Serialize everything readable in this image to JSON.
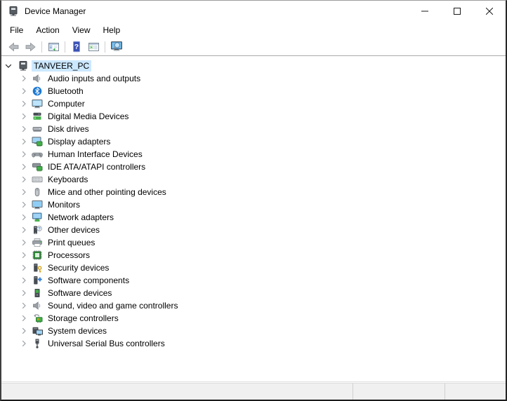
{
  "window": {
    "title": "Device Manager",
    "icon": "device-manager-icon"
  },
  "titlebar": {
    "controls": [
      {
        "name": "minimize",
        "icon": "minimize-icon"
      },
      {
        "name": "maximize",
        "icon": "maximize-icon"
      },
      {
        "name": "close",
        "icon": "close-icon"
      }
    ]
  },
  "menubar": {
    "items": [
      {
        "label": "File"
      },
      {
        "label": "Action"
      },
      {
        "label": "View"
      },
      {
        "label": "Help"
      }
    ]
  },
  "toolbar": {
    "buttons": [
      {
        "name": "back",
        "icon": "back-arrow-icon"
      },
      {
        "name": "forward",
        "icon": "forward-arrow-icon"
      },
      {
        "sep": true
      },
      {
        "name": "show-console-tree",
        "icon": "console-tree-icon"
      },
      {
        "sep": true
      },
      {
        "name": "help",
        "icon": "help-icon"
      },
      {
        "name": "show-action-pane",
        "icon": "action-pane-icon"
      },
      {
        "sep": true
      },
      {
        "name": "scan-hardware-changes",
        "icon": "scan-computer-icon"
      }
    ]
  },
  "tree": {
    "root": {
      "label": "TANVEER_PC",
      "icon": "pc-root-icon",
      "expanded": true,
      "selected": true
    },
    "items": [
      {
        "label": "Audio inputs and outputs",
        "icon": "speaker-icon"
      },
      {
        "label": "Bluetooth",
        "icon": "bluetooth-icon"
      },
      {
        "label": "Computer",
        "icon": "computer-icon"
      },
      {
        "label": "Digital Media Devices",
        "icon": "media-server-icon"
      },
      {
        "label": "Disk drives",
        "icon": "disk-drive-icon"
      },
      {
        "label": "Display adapters",
        "icon": "display-adapter-icon"
      },
      {
        "label": "Human Interface Devices",
        "icon": "gamepad-icon"
      },
      {
        "label": "IDE ATA/ATAPI controllers",
        "icon": "ide-controller-icon"
      },
      {
        "label": "Keyboards",
        "icon": "keyboard-icon"
      },
      {
        "label": "Mice and other pointing devices",
        "icon": "mouse-icon"
      },
      {
        "label": "Monitors",
        "icon": "monitor-icon"
      },
      {
        "label": "Network adapters",
        "icon": "network-adapter-icon"
      },
      {
        "label": "Other devices",
        "icon": "unknown-device-icon"
      },
      {
        "label": "Print queues",
        "icon": "printer-icon"
      },
      {
        "label": "Processors",
        "icon": "processor-icon"
      },
      {
        "label": "Security devices",
        "icon": "security-device-icon"
      },
      {
        "label": "Software components",
        "icon": "software-component-icon"
      },
      {
        "label": "Software devices",
        "icon": "software-device-icon"
      },
      {
        "label": "Sound, video and game controllers",
        "icon": "sound-controller-icon"
      },
      {
        "label": "Storage controllers",
        "icon": "storage-controller-icon"
      },
      {
        "label": "System devices",
        "icon": "system-device-icon"
      },
      {
        "label": "Universal Serial Bus controllers",
        "icon": "usb-controller-icon"
      }
    ]
  },
  "statusbar": {
    "sections": [
      "",
      "",
      ""
    ]
  },
  "colors": {
    "selection_highlight": "#cce8ff",
    "statusbar_bg": "#f0f0f0",
    "bluetooth_blue": "#1b78d3",
    "device_green": "#43b049",
    "help_blue": "#3a51b5",
    "screen_blue": "#9fd4f6"
  }
}
